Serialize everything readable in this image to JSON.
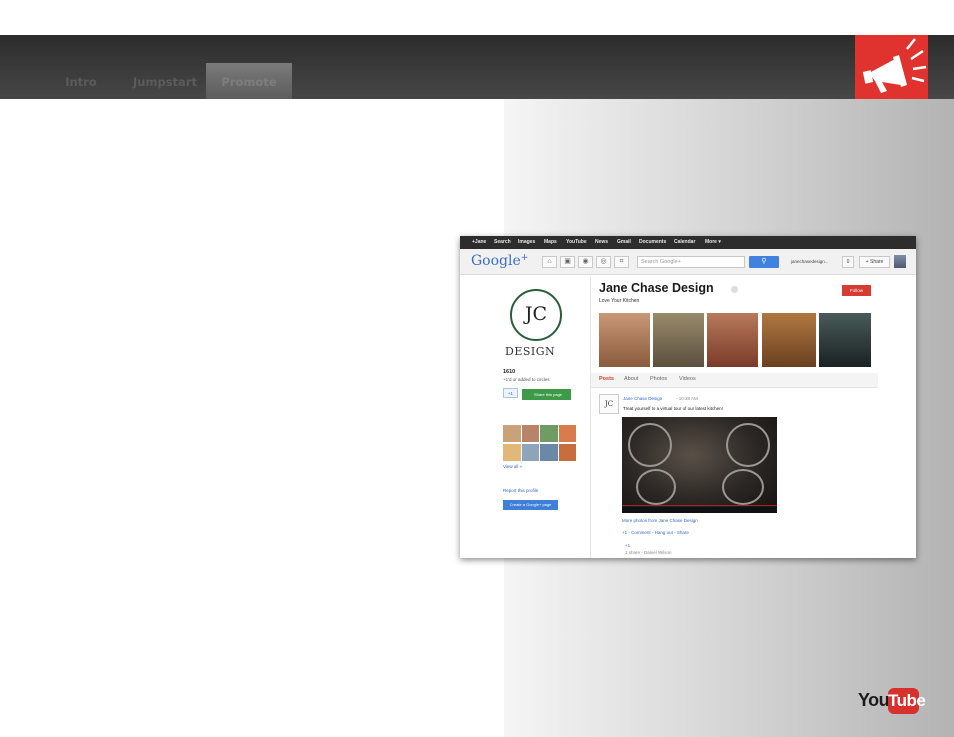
{
  "nav": {
    "tabs": [
      "Intro",
      "Jumpstart",
      "Promote"
    ],
    "active": "Promote"
  },
  "screenshot": {
    "gbar": [
      "+Jane",
      "Search",
      "Images",
      "Maps",
      "YouTube",
      "News",
      "Gmail",
      "Documents",
      "Calendar",
      "More ▾"
    ],
    "logo_text": "Google",
    "logo_plus": "+",
    "search_placeholder": "Search Google+",
    "user_label": "janechasedesign...",
    "notification_count": "0",
    "share_label": "+ Share",
    "brand": {
      "initials": "JC",
      "wordmark": "DESIGN"
    },
    "follower_count": "1610",
    "follower_text": "+1'd or added to circles",
    "plus_one": "+1",
    "share_page": "Share this page",
    "view_all": "View all »",
    "report": "Report this profile",
    "create_page": "Create a Google+ page",
    "page_name": "Jane Chase Design",
    "tagline": "Love Your Kitchen",
    "follow_button": "Follow",
    "tabs": [
      "Posts",
      "About",
      "Photos",
      "Videos"
    ],
    "post": {
      "author": "Jane Chase Design",
      "time": "-  10:38 AM",
      "text": "Treat yourself to a virtual tour of our latest kitchen!",
      "more_photos": "More photos from Jane Chase Design",
      "actions": "+1  -  Comment  -  Hang out  -  Share",
      "plus_count": "+1",
      "share_line": "1 share  -  Daniel Wilson"
    }
  },
  "youtube": {
    "you": "You",
    "tube": "Tube"
  },
  "colors": {
    "accent_red": "#e03330",
    "google_blue": "#4182e0",
    "share_green": "#3c9a48",
    "follow_red": "#d73b32"
  }
}
